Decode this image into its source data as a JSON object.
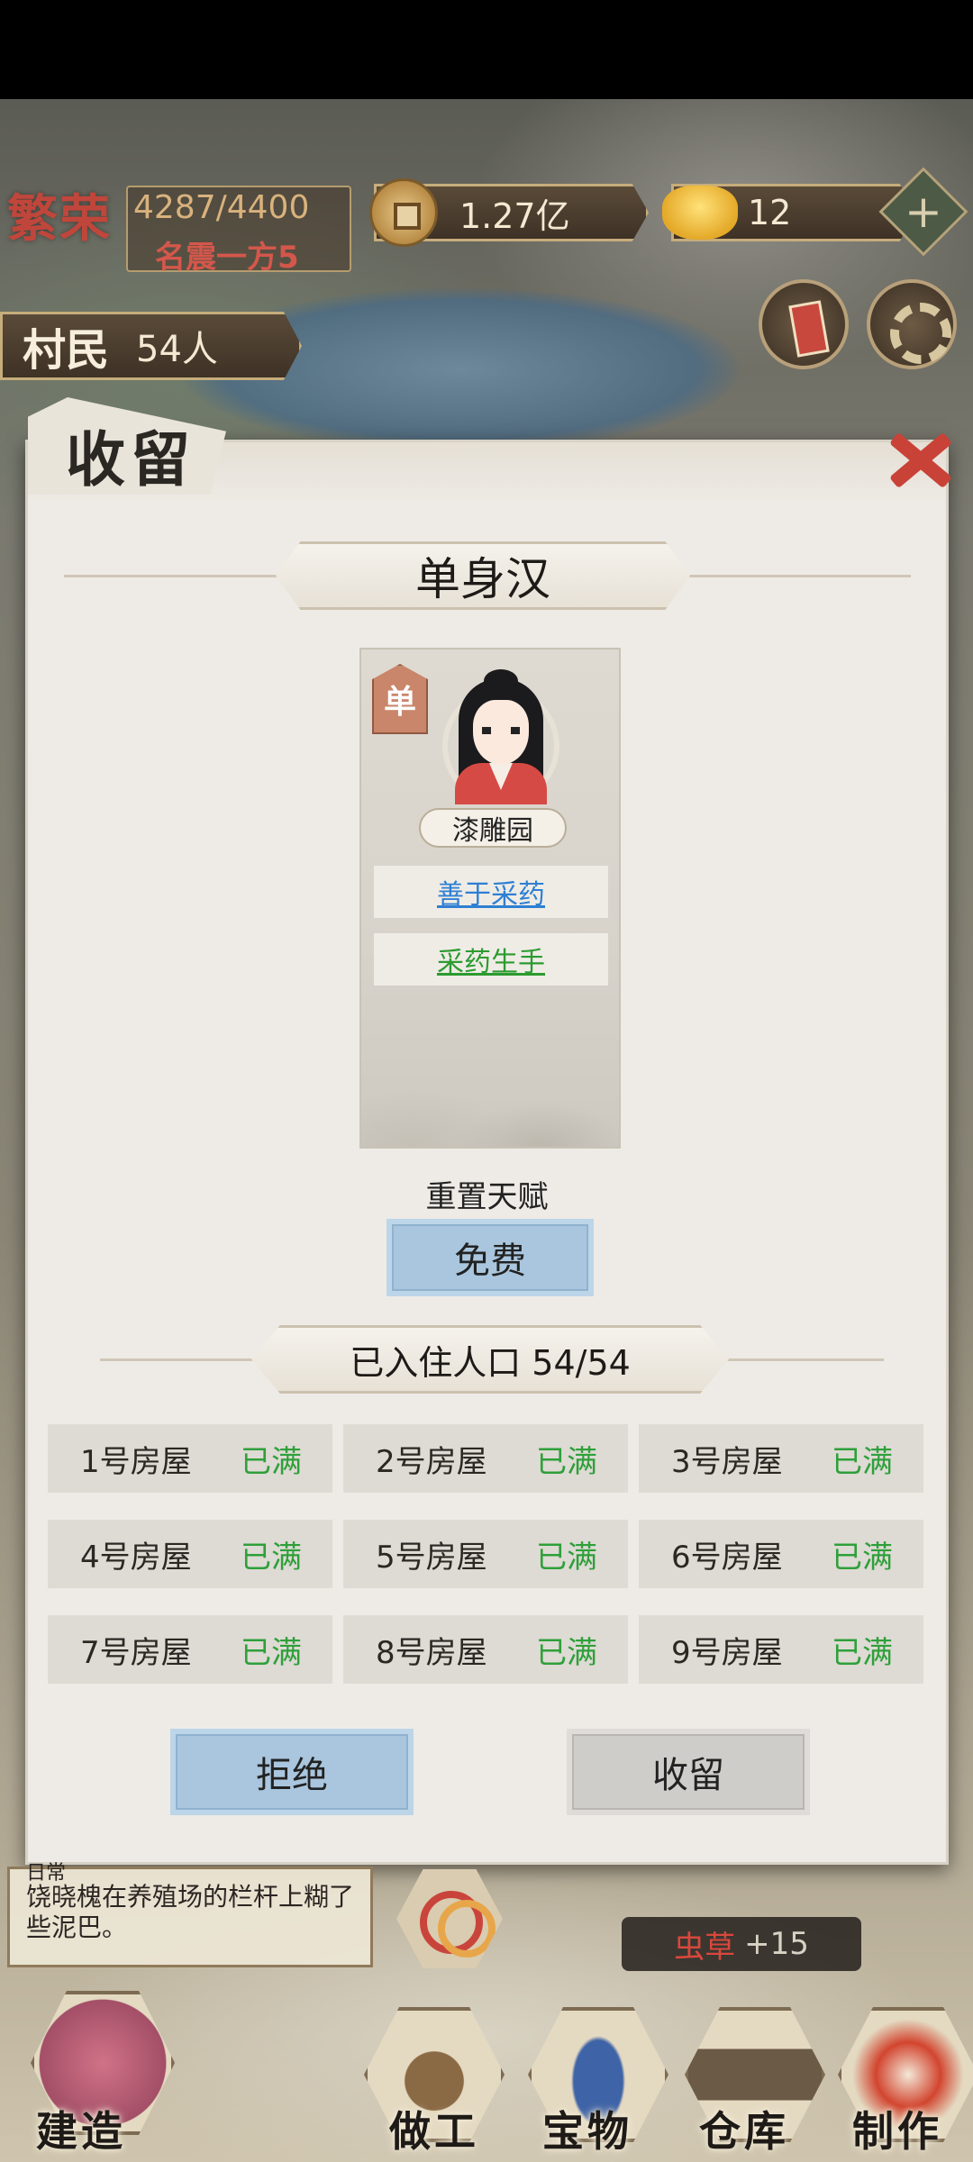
{
  "hud": {
    "fame_title": "繁荣",
    "fame_value": "4287/4400",
    "fame_rank": "名震一方5",
    "coins": "1.27亿",
    "gold": "12",
    "add_symbol": "+",
    "villager_label": "村民",
    "villager_count": "54人"
  },
  "dialog": {
    "title": "收留",
    "person_title": "单身汉",
    "single_tag": "单",
    "workplace": "漆雕园",
    "traits": [
      "善于采药",
      "采药生手"
    ],
    "trait_colors": [
      "#2f7fd3",
      "#2c9b30"
    ],
    "reset_label": "重置天赋",
    "free_button": "免费",
    "population": "已入住人口 54/54",
    "houses": [
      {
        "name": "1号房屋",
        "status": "已满"
      },
      {
        "name": "2号房屋",
        "status": "已满"
      },
      {
        "name": "3号房屋",
        "status": "已满"
      },
      {
        "name": "4号房屋",
        "status": "已满"
      },
      {
        "name": "5号房屋",
        "status": "已满"
      },
      {
        "name": "6号房屋",
        "status": "已满"
      },
      {
        "name": "7号房屋",
        "status": "已满"
      },
      {
        "name": "8号房屋",
        "status": "已满"
      },
      {
        "name": "9号房屋",
        "status": "已满"
      }
    ],
    "reject_button": "拒绝",
    "shelter_button": "收留"
  },
  "log": {
    "title": "日常",
    "text": "饶晓槐在养殖场的栏杆上糊了些泥巴。"
  },
  "reward": {
    "item": "虫草",
    "amount": "+15"
  },
  "nav": {
    "build": "建造",
    "work": "做工",
    "treasure": "宝物",
    "storage": "仓库",
    "craft": "制作"
  },
  "colors": {
    "accent_red": "#c94237",
    "status_green": "#2ea03a",
    "button_blue": "#a9c6de"
  }
}
